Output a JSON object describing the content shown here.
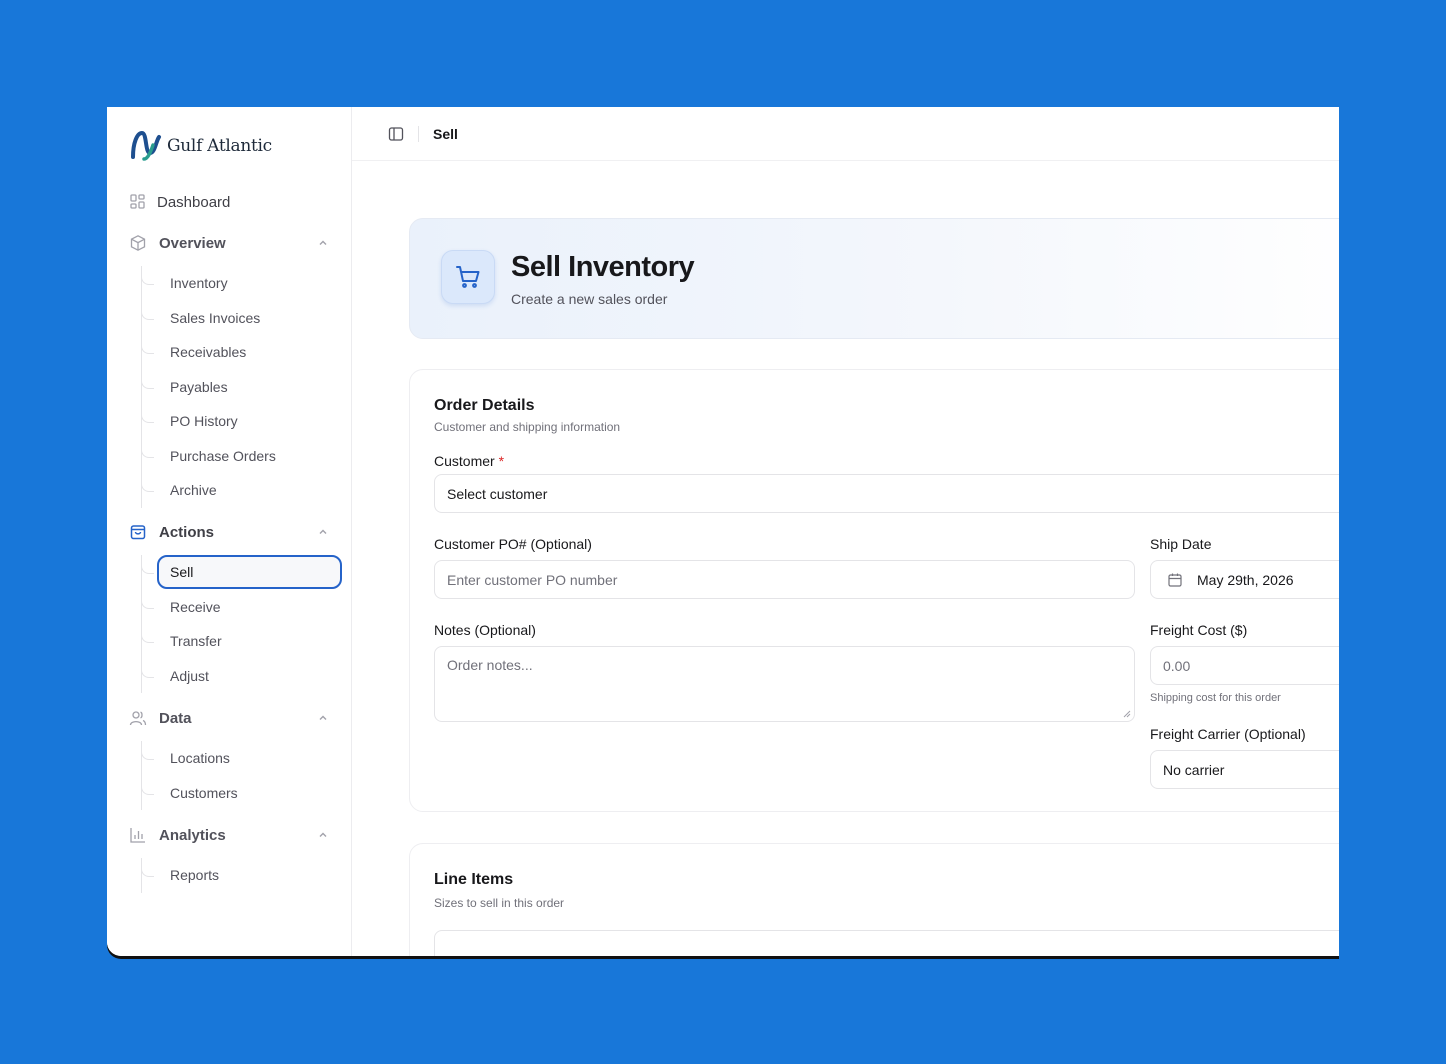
{
  "brand": {
    "name": "Gulf Atlantic"
  },
  "sidebar": {
    "dashboard": {
      "label": "Dashboard",
      "icon": "dashboard-icon"
    },
    "overview": {
      "label": "Overview",
      "icon": "package-icon",
      "items": [
        "Inventory",
        "Sales Invoices",
        "Receivables",
        "Payables",
        "PO History",
        "Purchase Orders",
        "Archive"
      ]
    },
    "actions": {
      "label": "Actions",
      "icon": "shopping-bag-icon",
      "items": [
        "Sell",
        "Receive",
        "Transfer",
        "Adjust"
      ],
      "selected": "Sell"
    },
    "data": {
      "label": "Data",
      "icon": "users-icon",
      "items": [
        "Locations",
        "Customers"
      ]
    },
    "analytics": {
      "label": "Analytics",
      "icon": "bar-chart-icon",
      "items": [
        "Reports"
      ]
    }
  },
  "topbar": {
    "breadcrumb": "Sell"
  },
  "hero": {
    "title": "Sell Inventory",
    "subtitle": "Create a new sales order",
    "icon": "cart-icon"
  },
  "order_details": {
    "title": "Order Details",
    "subtitle": "Customer and shipping information",
    "customer": {
      "label": "Customer",
      "required_mark": "*",
      "value": "Select customer"
    },
    "customer_po": {
      "label": "Customer PO# (Optional)",
      "placeholder": "Enter customer PO number"
    },
    "ship_date": {
      "label": "Ship Date",
      "value": "May 29th, 2026"
    },
    "notes": {
      "label": "Notes (Optional)",
      "placeholder": "Order notes..."
    },
    "freight_cost": {
      "label": "Freight Cost ($)",
      "placeholder": "0.00",
      "hint": "Shipping cost for this order"
    },
    "freight_carrier": {
      "label": "Freight Carrier (Optional)",
      "value": "No carrier"
    }
  },
  "line_items": {
    "title": "Line Items",
    "subtitle": "Sizes to sell in this order"
  },
  "colors": {
    "accent": "#2563c9",
    "background": "#1877d9",
    "required": "#dc2626"
  }
}
